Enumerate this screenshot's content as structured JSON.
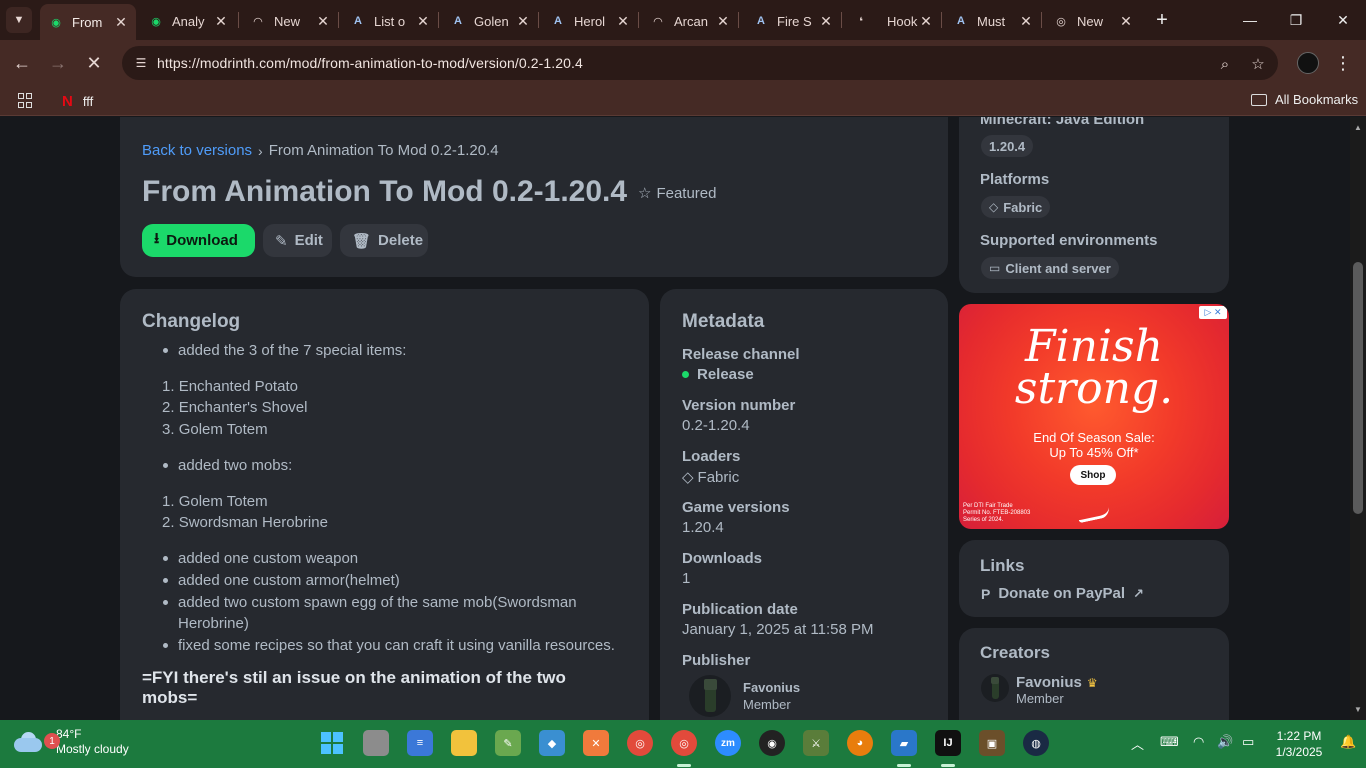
{
  "browser": {
    "tabs": [
      {
        "title": "From",
        "active": true
      },
      {
        "title": "Analy"
      },
      {
        "title": "New"
      },
      {
        "title": "List o"
      },
      {
        "title": "Golen"
      },
      {
        "title": "Herol"
      },
      {
        "title": "Arcan"
      },
      {
        "title": "Fire S"
      },
      {
        "title": "Hook"
      },
      {
        "title": "Must"
      },
      {
        "title": "New"
      }
    ],
    "url": "https://modrinth.com/mod/from-animation-to-mod/version/0.2-1.20.4",
    "bookmarks": [
      {
        "label": "fff"
      }
    ],
    "all_bookmarks": "All Bookmarks"
  },
  "version": {
    "breadcrumb_link": "Back to versions",
    "breadcrumb_current": "From Animation To Mod 0.2-1.20.4",
    "title": "From Animation To Mod 0.2-1.20.4",
    "featured": "Featured",
    "buttons": {
      "download": "Download",
      "edit": "Edit",
      "delete": "Delete"
    }
  },
  "changelog": {
    "heading": "Changelog",
    "bullet1": "added the 3 of the 7 special items:",
    "items1": [
      "Enchanted Potato",
      "Enchanter's Shovel",
      "Golem Totem"
    ],
    "bullet2": "added two mobs:",
    "items2": [
      "Golem Totem",
      "Swordsman Herobrine"
    ],
    "bullets3": [
      "added one custom weapon",
      "added one custom armor(helmet)",
      "added two custom spawn egg of the same mob(Swordsman",
      "Herobrine)",
      "fixed some recipes so that you can craft it using vanilla resources."
    ],
    "fyi": "=FYI there's stil an issue on the animation of the two mobs="
  },
  "metadata": {
    "heading": "Metadata",
    "release_channel_label": "Release channel",
    "release_channel": "Release",
    "version_number_label": "Version number",
    "version_number": "0.2-1.20.4",
    "loaders_label": "Loaders",
    "loader": "Fabric",
    "game_versions_label": "Game versions",
    "game_version": "1.20.4",
    "downloads_label": "Downloads",
    "downloads": "1",
    "publication_date_label": "Publication date",
    "publication_date": "January 1, 2025 at 11:58 PM",
    "publisher_label": "Publisher",
    "publisher_name": "Favonius",
    "publisher_role": "Member"
  },
  "sidebar": {
    "minecraft_label": "Minecraft: Java Edition",
    "minecraft_version": "1.20.4",
    "platforms_label": "Platforms",
    "platform": "Fabric",
    "environments_label": "Supported environments",
    "environment": "Client and server",
    "links_heading": "Links",
    "donate": "Donate on PayPal",
    "creators_heading": "Creators",
    "creator_name": "Favonius",
    "creator_role": "Member"
  },
  "ad": {
    "headline1": "Finish",
    "headline2": "strong.",
    "sub1": "End Of Season Sale:",
    "sub2": "Up To 45% Off*",
    "button": "Shop",
    "fine1": "Per DTI Fair Trade",
    "fine2": "Permit No. FTEB-208803",
    "fine3": "Series of 2024."
  },
  "taskbar": {
    "weather_badge": "1",
    "temp": "84°F",
    "condition": "Mostly cloudy",
    "time": "1:22 PM",
    "date": "1/3/2025"
  },
  "colors": {
    "accent": "#1bd96a",
    "link": "#4f9cf9",
    "card": "#26292f",
    "page_bg": "#16181c",
    "tabbar": "#2b1a17",
    "taskbar": "#1c7a3e"
  }
}
